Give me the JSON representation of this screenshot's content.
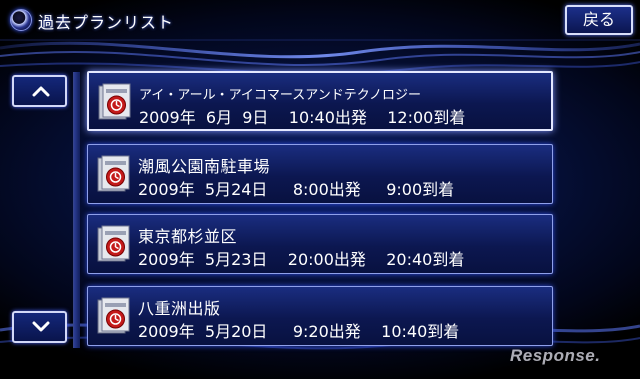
{
  "header": {
    "title": "過去プランリスト",
    "back_label": "戻る"
  },
  "nav": {
    "up_icon": "chevron-up-icon",
    "down_icon": "chevron-down-icon"
  },
  "plans": [
    {
      "name": "アイ・アール・アイコマースアンドテクノロジー",
      "time": "2009年  6月  9日    10:40出発    12:00到着",
      "icon": "route-history-icon",
      "selected": true
    },
    {
      "name": "潮風公園南駐車場",
      "time": "2009年  5月24日     8:00出発     9:00到着",
      "icon": "route-history-icon",
      "selected": false
    },
    {
      "name": "東京都杉並区",
      "time": "2009年  5月23日    20:00出発    20:40到着",
      "icon": "route-history-icon",
      "selected": false
    },
    {
      "name": "八重洲出版",
      "time": "2009年  5月20日     9:20出発    10:40到着",
      "icon": "route-history-icon",
      "selected": false
    }
  ],
  "watermark": "Response.",
  "colors": {
    "background": "#06113d",
    "accent": "#2f4bdc",
    "border": "#8fa0ea",
    "text": "#ffffff"
  }
}
